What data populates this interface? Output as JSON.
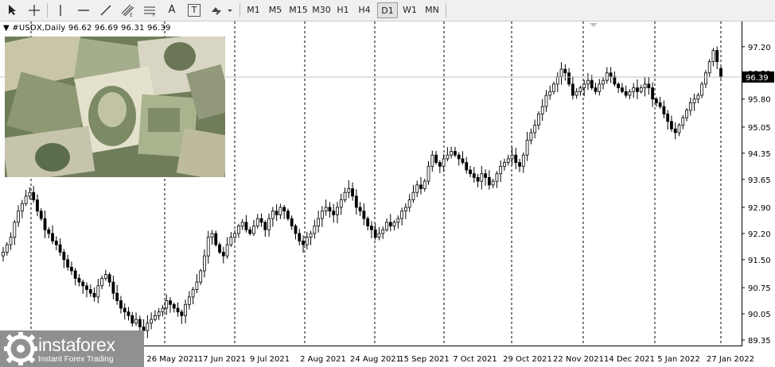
{
  "toolbar": {
    "tools": [
      {
        "name": "cursor-tool",
        "icon": "arrow-cursor-icon"
      },
      {
        "name": "crosshair-tool",
        "icon": "crosshair-icon"
      },
      {
        "name": "vertical-line-tool",
        "icon": "vertical-line-icon"
      },
      {
        "name": "horizontal-line-tool",
        "icon": "horizontal-line-icon"
      },
      {
        "name": "trendline-tool",
        "icon": "trendline-icon"
      },
      {
        "name": "equidistant-channel-tool",
        "icon": "channel-icon"
      },
      {
        "name": "fibonacci-tool",
        "icon": "fibonacci-icon"
      },
      {
        "name": "text-tool",
        "icon": "text-icon",
        "label": "A"
      },
      {
        "name": "text-label-tool",
        "icon": "text-label-icon",
        "label": "T"
      },
      {
        "name": "shapes-tool",
        "icon": "shapes-dropdown-icon"
      }
    ],
    "periods": [
      "M1",
      "M5",
      "M15",
      "M30",
      "H1",
      "H4",
      "D1",
      "W1",
      "MN"
    ],
    "active_period": "D1"
  },
  "symbol": {
    "header": "▼ #USDX,Daily  96.62 96.69 96.31 96.39"
  },
  "chart_data": {
    "type": "candlestick",
    "title": "#USDX,Daily",
    "ohlc_last": {
      "open": 96.62,
      "high": 96.69,
      "low": 96.31,
      "close": 96.39
    },
    "current_price": "96.39",
    "y_ticks": [
      "97.20",
      "96.50",
      "95.80",
      "95.05",
      "94.35",
      "93.65",
      "92.90",
      "92.20",
      "91.50",
      "90.75",
      "90.05",
      "89.35"
    ],
    "ylim": [
      89.2,
      97.75
    ],
    "x_labels": [
      "26 May 2021",
      "17 Jun 2021",
      "9 Jul 2021",
      "2 Aug 2021",
      "24 Aug 2021",
      "15 Sep 2021",
      "7 Oct 2021",
      "29 Oct 2021",
      "22 Nov 2021",
      "14 Dec 2021",
      "5 Jan 2022",
      "27 Jan 2022"
    ],
    "closes": [
      91.7,
      91.9,
      92.1,
      92.5,
      92.8,
      93.0,
      93.2,
      93.3,
      93.1,
      92.8,
      92.6,
      92.3,
      92.2,
      92.0,
      91.9,
      91.7,
      91.5,
      91.3,
      91.2,
      91.0,
      90.9,
      90.8,
      90.7,
      90.6,
      90.5,
      90.8,
      91.0,
      91.1,
      90.9,
      90.6,
      90.4,
      90.2,
      90.1,
      90.0,
      89.8,
      89.9,
      89.7,
      89.6,
      89.8,
      89.9,
      90.0,
      90.1,
      90.2,
      90.4,
      90.3,
      90.2,
      90.1,
      90.0,
      90.3,
      90.5,
      90.7,
      90.9,
      91.2,
      91.6,
      92.1,
      92.2,
      91.9,
      91.7,
      91.6,
      91.9,
      92.1,
      92.2,
      92.4,
      92.5,
      92.3,
      92.2,
      92.4,
      92.6,
      92.5,
      92.3,
      92.6,
      92.8,
      92.7,
      92.9,
      92.8,
      92.6,
      92.4,
      92.2,
      92.0,
      91.9,
      92.1,
      92.2,
      92.4,
      92.6,
      92.8,
      92.9,
      92.8,
      92.7,
      92.9,
      93.1,
      93.3,
      93.4,
      93.2,
      92.9,
      92.8,
      92.6,
      92.4,
      92.3,
      92.1,
      92.2,
      92.3,
      92.5,
      92.4,
      92.5,
      92.6,
      92.8,
      92.9,
      93.1,
      93.3,
      93.5,
      93.4,
      93.6,
      94.0,
      94.3,
      94.1,
      94.0,
      94.2,
      94.3,
      94.4,
      94.3,
      94.2,
      94.1,
      93.9,
      93.8,
      93.7,
      93.6,
      93.8,
      93.7,
      93.5,
      93.6,
      93.8,
      94.0,
      94.1,
      94.2,
      94.3,
      94.1,
      94.0,
      94.3,
      94.7,
      94.9,
      95.1,
      95.4,
      95.6,
      95.9,
      96.0,
      96.2,
      96.4,
      96.6,
      96.5,
      96.2,
      95.9,
      96.0,
      96.1,
      96.2,
      96.3,
      96.1,
      96.0,
      96.2,
      96.3,
      96.5,
      96.4,
      96.2,
      96.1,
      96.0,
      95.9,
      96.0,
      96.1,
      96.0,
      96.1,
      96.2,
      96.1,
      95.8,
      95.7,
      95.6,
      95.4,
      95.2,
      95.0,
      94.9,
      95.1,
      95.3,
      95.5,
      95.7,
      95.8,
      95.9,
      96.2,
      96.5,
      96.8,
      97.1,
      96.8,
      96.39
    ],
    "vertical_grid_dates": [
      "26 May 2021",
      "17 Jun 2021",
      "9 Jul 2021",
      "2 Aug 2021",
      "24 Aug 2021",
      "15 Sep 2021",
      "7 Oct 2021",
      "29 Oct 2021",
      "22 Nov 2021",
      "14 Dec 2021",
      "5 Jan 2022",
      "27 Jan 2022"
    ],
    "grid": "vertical-dashed",
    "colors": {
      "candle": "#000000",
      "background": "#ffffff",
      "price_line": "#c0c0c0"
    }
  },
  "branding": {
    "logo_text": "instaforex",
    "logo_subtext": "Instant Forex Trading",
    "background_color": "#8f9092"
  },
  "image": {
    "name": "dollar-bills-photo"
  }
}
